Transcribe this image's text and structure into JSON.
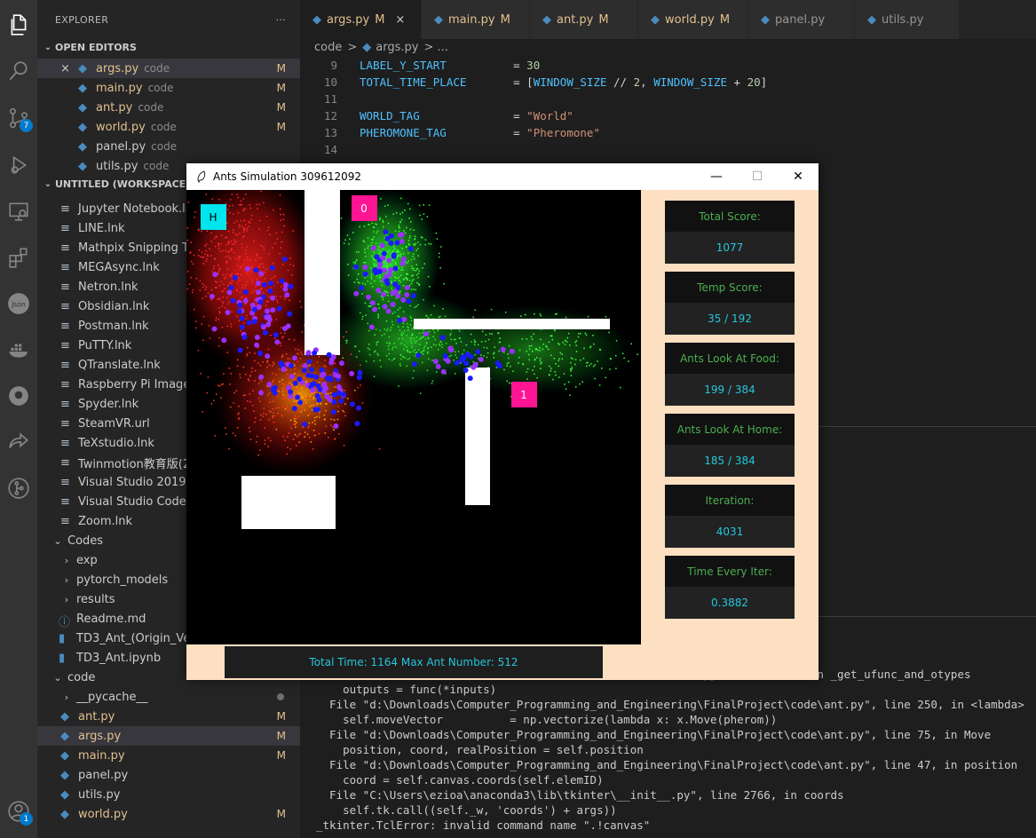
{
  "activity_bar": {
    "items": [
      {
        "name": "files-icon",
        "active": true
      },
      {
        "name": "search-icon"
      },
      {
        "name": "source-control-icon",
        "badge": "7"
      },
      {
        "name": "run-debug-icon"
      },
      {
        "name": "remote-explorer-icon"
      },
      {
        "name": "extensions-icon"
      },
      {
        "name": "json-icon",
        "text": "Json"
      },
      {
        "name": "docker-icon"
      },
      {
        "name": "github-icon"
      },
      {
        "name": "live-share-icon"
      },
      {
        "name": "git-graph-icon"
      }
    ],
    "accounts_badge": "1"
  },
  "explorer": {
    "title": "EXPLORER",
    "more": "···",
    "open_editors_label": "OPEN EDITORS",
    "open_editors": [
      {
        "name": "args.py",
        "hint": "code",
        "status": "M",
        "close": "×"
      },
      {
        "name": "main.py",
        "hint": "code",
        "status": "M"
      },
      {
        "name": "ant.py",
        "hint": "code",
        "status": "M"
      },
      {
        "name": "world.py",
        "hint": "code",
        "status": "M"
      },
      {
        "name": "panel.py",
        "hint": "code",
        "status": ""
      },
      {
        "name": "utils.py",
        "hint": "code",
        "status": ""
      }
    ],
    "workspace_label": "UNTITLED (WORKSPACE)",
    "workspace_files": [
      "Jupyter Notebook.lnk",
      "LINE.lnk",
      "Mathpix Snipping Too",
      "MEGAsync.lnk",
      "Netron.lnk",
      "Obsidian.lnk",
      "Postman.lnk",
      "PuTTY.lnk",
      "QTranslate.lnk",
      "Raspberry Pi Imager.ln",
      "Spyder.lnk",
      "SteamVR.url",
      "TeXstudio.lnk",
      "Twinmotion教育版(20",
      "Visual Studio 2019.lnk",
      "Visual Studio Code.lnk",
      "Zoom.lnk"
    ],
    "codes_folder": "Codes",
    "codes_children": [
      "exp",
      "pytorch_models",
      "results"
    ],
    "codes_files": [
      "Readme.md",
      "TD3_Ant_(Origin_Versi",
      "TD3_Ant.ipynb"
    ],
    "code_folder": "code",
    "code_children": [
      {
        "name": "__pycache__",
        "type": "folder",
        "status": "dot"
      },
      {
        "name": "ant.py",
        "type": "py",
        "status": "M"
      },
      {
        "name": "args.py",
        "type": "py",
        "status": "M",
        "selected": true
      },
      {
        "name": "main.py",
        "type": "py",
        "status": "M"
      },
      {
        "name": "panel.py",
        "type": "py",
        "status": ""
      },
      {
        "name": "utils.py",
        "type": "py",
        "status": ""
      },
      {
        "name": "world.py",
        "type": "py",
        "status": "M"
      }
    ]
  },
  "tabs": [
    {
      "name": "args.py",
      "status": "M",
      "active": true,
      "close": "×"
    },
    {
      "name": "main.py",
      "status": "M"
    },
    {
      "name": "ant.py",
      "status": "M"
    },
    {
      "name": "world.py",
      "status": "M"
    },
    {
      "name": "panel.py",
      "status": ""
    },
    {
      "name": "utils.py",
      "status": ""
    }
  ],
  "breadcrumb": {
    "folder": "code",
    "sep": ">",
    "file": "args.py",
    "more": "> ..."
  },
  "code_lines": [
    {
      "num": "9",
      "var": "LABEL_Y_START",
      "pad": "          ",
      "rest": [
        [
          "op",
          "= "
        ],
        [
          "num",
          "30"
        ]
      ]
    },
    {
      "num": "10",
      "var": "TOTAL_TIME_PLACE",
      "pad": "       ",
      "rest": [
        [
          "op",
          "= ["
        ],
        [
          "var",
          "WINDOW_SIZE"
        ],
        [
          "op",
          " // "
        ],
        [
          "num",
          "2"
        ],
        [
          "op",
          ", "
        ],
        [
          "var",
          "WINDOW_SIZE"
        ],
        [
          "op",
          " + "
        ],
        [
          "num",
          "20"
        ],
        [
          "op",
          "]"
        ]
      ]
    },
    {
      "num": "11",
      "var": "",
      "pad": "",
      "rest": []
    },
    {
      "num": "12",
      "var": "WORLD_TAG",
      "pad": "              ",
      "rest": [
        [
          "op",
          "= "
        ],
        [
          "str",
          "\"World\""
        ]
      ]
    },
    {
      "num": "13",
      "var": "PHEROMONE_TAG",
      "pad": "          ",
      "rest": [
        [
          "op",
          "= "
        ],
        [
          "str",
          "\"Pheromone\""
        ]
      ]
    },
    {
      "num": "14",
      "var": "",
      "pad": "",
      "rest": []
    }
  ],
  "terminal_lines": [
    "                                                       ...py\", line 2151, in _get_ufunc_and_otypes",
    "    outputs = func(*inputs)",
    "  File \"d:\\Downloads\\Computer_Programming_and_Engineering\\FinalProject\\code\\ant.py\", line 250, in <lambda>",
    "    self.moveVector          = np.vectorize(lambda x: x.Move(pherom))",
    "  File \"d:\\Downloads\\Computer_Programming_and_Engineering\\FinalProject\\code\\ant.py\", line 75, in Move",
    "    position, coord, realPosition = self.position",
    "  File \"d:\\Downloads\\Computer_Programming_and_Engineering\\FinalProject\\code\\ant.py\", line 47, in position",
    "    coord = self.canvas.coords(self.elemID)",
    "  File \"C:\\Users\\ezioa\\anaconda3\\lib\\tkinter\\__init__.py\", line 2766, in coords",
    "    self.tk.call((self._w, 'coords') + args))",
    "_tkinter.TclError: invalid command name \".!canvas\""
  ],
  "sim_window": {
    "title": "Ants Simulation 309612092",
    "minimize": "—",
    "maximize": "☐",
    "close": "✕",
    "home_label": "H",
    "food_labels": [
      "0",
      "1"
    ],
    "colors": {
      "home": "#00e5ee",
      "food": "#ff1493",
      "wall": "#ffffff",
      "home_pheromone": "#ff2020",
      "food_pheromone": "#33ff33",
      "ant_searching": "#1a1aff",
      "ant_returning": "#9b30ff",
      "panel_bg": "#fde0c2"
    },
    "status": "Total Time: 1164   Max Ant Number: 512",
    "cards": [
      {
        "label": "Total Score:",
        "value": "1077"
      },
      {
        "label": "Temp Score:",
        "value": "35 / 192"
      },
      {
        "label": "Ants Look At Food:",
        "value": "199 / 384"
      },
      {
        "label": "Ants Look At Home:",
        "value": "185 / 384"
      },
      {
        "label": "Iteration:",
        "value": "4031"
      },
      {
        "label": "Time Every Iter:",
        "value": "0.3882"
      }
    ]
  }
}
